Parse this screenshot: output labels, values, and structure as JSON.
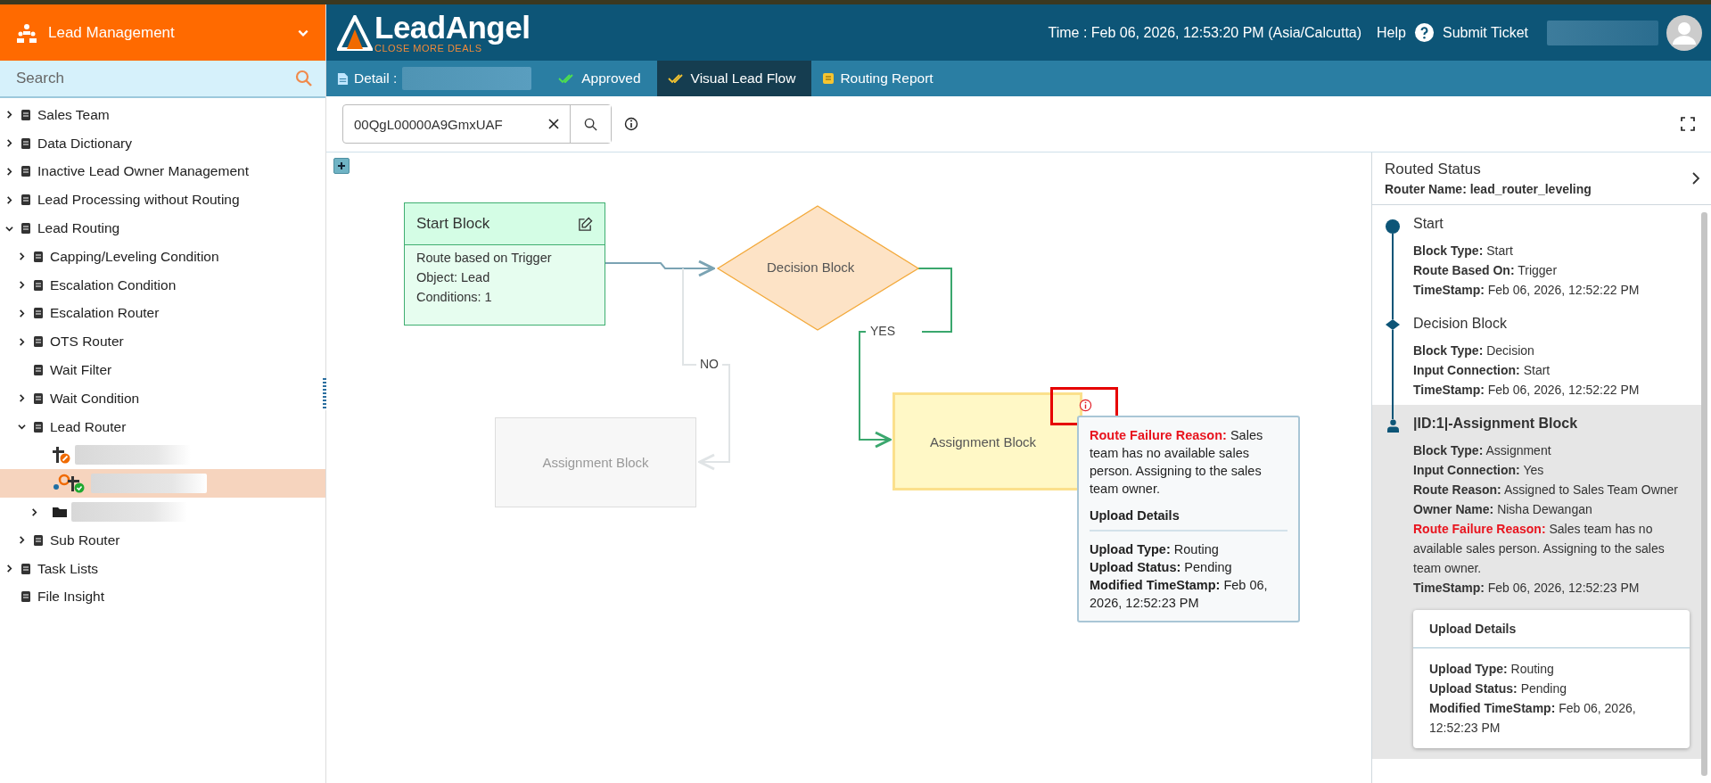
{
  "app_menu": {
    "title": "Lead Management",
    "expanded": false
  },
  "sidebar": {
    "search": {
      "placeholder": "Search"
    },
    "items": [
      {
        "label": "Sales Team",
        "expanded": false,
        "selected": false
      },
      {
        "label": "Data Dictionary",
        "expanded": false,
        "selected": false
      },
      {
        "label": "Inactive Lead Owner Management",
        "expanded": false,
        "selected": false
      },
      {
        "label": "Lead Processing without Routing",
        "expanded": false,
        "selected": false
      },
      {
        "label": "Lead Routing",
        "expanded": true,
        "selected": false,
        "children": [
          {
            "label": "Capping/Leveling Condition",
            "expanded": false,
            "selected": false
          },
          {
            "label": "Escalation Condition",
            "expanded": false,
            "selected": false
          },
          {
            "label": "Escalation Router",
            "expanded": false,
            "selected": false
          },
          {
            "label": "OTS Router",
            "expanded": false,
            "selected": false
          },
          {
            "label": "Wait Filter",
            "selected": false
          },
          {
            "label": "Wait Condition",
            "expanded": false,
            "selected": false
          },
          {
            "label": "Lead Router",
            "expanded": true,
            "selected": false,
            "children": [
              {
                "kind": "router-inactive",
                "selected": false
              },
              {
                "kind": "router-active",
                "selected": true
              },
              {
                "kind": "folder",
                "expanded": false,
                "selected": false
              }
            ]
          },
          {
            "label": "Sub Router",
            "expanded": false,
            "selected": false
          }
        ]
      },
      {
        "label": "Task Lists",
        "expanded": false,
        "selected": false
      },
      {
        "label": "File Insight",
        "selected": false
      }
    ]
  },
  "header": {
    "logo": {
      "name": "LeadAngel",
      "tagline": "CLOSE MORE DEALS"
    },
    "time": "Time : Feb 06, 2026, 12:53:20 PM (Asia/Calcutta)",
    "help": "Help",
    "submit_ticket": "Submit Ticket"
  },
  "tabs": [
    {
      "kind": "detail",
      "label": "Detail :",
      "selected": false
    },
    {
      "kind": "approved",
      "label": "Approved",
      "selected": false
    },
    {
      "kind": "flow",
      "label": "Visual Lead Flow",
      "selected": true
    },
    {
      "kind": "report",
      "label": "Routing Report",
      "selected": false
    }
  ],
  "lookup": {
    "value": "00QgL00000A9GmxUAF"
  },
  "flow": {
    "start_block": {
      "title": "Start Block",
      "lines": [
        "Route based on Trigger",
        "Object: Lead",
        "Conditions: 1"
      ]
    },
    "decision_block": {
      "title": "Decision Block"
    },
    "assignment_blocks": [
      {
        "title": "Assignment Block",
        "active": false
      },
      {
        "title": "Assignment Block",
        "active": true
      }
    ],
    "edges": [
      {
        "label": "NO",
        "taken": false
      },
      {
        "label": "YES",
        "taken": true
      }
    ],
    "tooltip": {
      "fields": [
        {
          "kind": "failure",
          "label": "Route Failure Reason:",
          "value": "Sales team has no available sales person. Assigning to the sales team owner."
        }
      ],
      "section": "Upload Details",
      "details": [
        {
          "label": "Upload Type:",
          "value": "Routing"
        },
        {
          "label": "Upload Status:",
          "value": "Pending"
        },
        {
          "label": "Modified TimeStamp:",
          "value": "Feb 06, 2026, 12:52:23 PM"
        }
      ]
    }
  },
  "routed_status": {
    "title": "Routed Status",
    "router_label": "Router Name:",
    "router_name": "lead_router_leveling",
    "entries": [
      {
        "kind": "start",
        "title": "Start",
        "selected": false,
        "fields": [
          {
            "label": "Block Type:",
            "value": "Start"
          },
          {
            "label": "Route Based On:",
            "value": "Trigger"
          },
          {
            "label": "TimeStamp:",
            "value": "Feb 06, 2026, 12:52:22 PM"
          }
        ]
      },
      {
        "kind": "decision",
        "title": "Decision Block",
        "selected": false,
        "fields": [
          {
            "label": "Block Type:",
            "value": "Decision"
          },
          {
            "label": "Input Connection:",
            "value": "Start"
          },
          {
            "label": "TimeStamp:",
            "value": "Feb 06, 2026, 12:52:22 PM"
          }
        ]
      },
      {
        "kind": "assignment",
        "title": "|ID:1|-Assignment Block",
        "selected": true,
        "fields": [
          {
            "kind": "normal",
            "label": "Block Type:",
            "value": "Assignment"
          },
          {
            "kind": "normal",
            "label": "Input Connection:",
            "value": "Yes"
          },
          {
            "kind": "normal",
            "label": "Route Reason:",
            "value": "Assigned to Sales Team Owner"
          },
          {
            "kind": "normal",
            "label": "Owner Name:",
            "value": "Nisha Dewangan"
          },
          {
            "kind": "failure",
            "label": "Route Failure Reason:",
            "value": "Sales team has no available sales person. Assigning to the sales team owner."
          },
          {
            "kind": "normal",
            "label": "TimeStamp:",
            "value": "Feb 06, 2026, 12:52:23 PM"
          }
        ],
        "upload": {
          "title": "Upload Details",
          "fields": [
            {
              "label": "Upload Type:",
              "value": "Routing"
            },
            {
              "label": "Upload Status:",
              "value": "Pending"
            },
            {
              "label": "Modified TimeStamp:",
              "value": "Feb 06, 2026, 12:52:23 PM"
            }
          ]
        }
      }
    ]
  }
}
